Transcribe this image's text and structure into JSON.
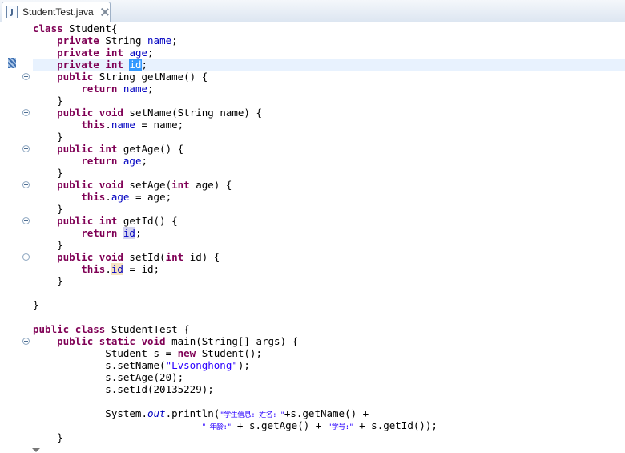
{
  "tab": {
    "title": "StudentTest.java",
    "icon": "J"
  },
  "code": {
    "l1": [
      "class",
      " Student{"
    ],
    "l2": [
      "    ",
      "private",
      " String ",
      "name",
      ";"
    ],
    "l3": [
      "    ",
      "private",
      " ",
      "int",
      " ",
      "age",
      ";"
    ],
    "l4": [
      "    ",
      "private",
      " ",
      "int",
      " ",
      "id",
      ";"
    ],
    "l5": [
      "    ",
      "public",
      " String getName() {"
    ],
    "l6": [
      "        ",
      "return",
      " ",
      "name",
      ";"
    ],
    "l7": "    }",
    "l8": [
      "    ",
      "public",
      " ",
      "void",
      " setName(String name) {"
    ],
    "l9": [
      "        ",
      "this",
      ".",
      "name",
      " = name;"
    ],
    "l10": "    }",
    "l11": [
      "    ",
      "public",
      " ",
      "int",
      " getAge() {"
    ],
    "l12": [
      "        ",
      "return",
      " ",
      "age",
      ";"
    ],
    "l13": "    }",
    "l14": [
      "    ",
      "public",
      " ",
      "void",
      " setAge(",
      "int",
      " age) {"
    ],
    "l15": [
      "        ",
      "this",
      ".",
      "age",
      " = age;"
    ],
    "l16": "    }",
    "l17": [
      "    ",
      "public",
      " ",
      "int",
      " getId() {"
    ],
    "l18": [
      "        ",
      "return",
      " ",
      "id",
      ";"
    ],
    "l19": "    }",
    "l20": [
      "    ",
      "public",
      " ",
      "void",
      " setId(",
      "int",
      " id) {"
    ],
    "l21": [
      "        ",
      "this",
      ".",
      "id",
      " = id;"
    ],
    "l22": "    }",
    "l23": "",
    "l24": "}",
    "l25": "",
    "l26": [
      "public",
      " ",
      "class",
      " StudentTest {"
    ],
    "l27": [
      "    ",
      "public",
      " ",
      "static",
      " ",
      "void",
      " main(String[] args) {"
    ],
    "l28": [
      "            Student s = ",
      "new",
      " Student();"
    ],
    "l29": [
      "            s.setName(",
      "\"Lvsonghong\"",
      ");"
    ],
    "l30": "            s.setAge(20);",
    "l31": "            s.setId(20135229);",
    "l32": "",
    "l33": [
      "            System.",
      "out",
      ".println(",
      "\"学生信息: 姓名: \"",
      "+s.getName() +"
    ],
    "l34": [
      "                            ",
      "\" 年龄:\"",
      " + s.getAge() + ",
      "\"学号:\"",
      " + s.getId());"
    ],
    "l35": "    }"
  }
}
